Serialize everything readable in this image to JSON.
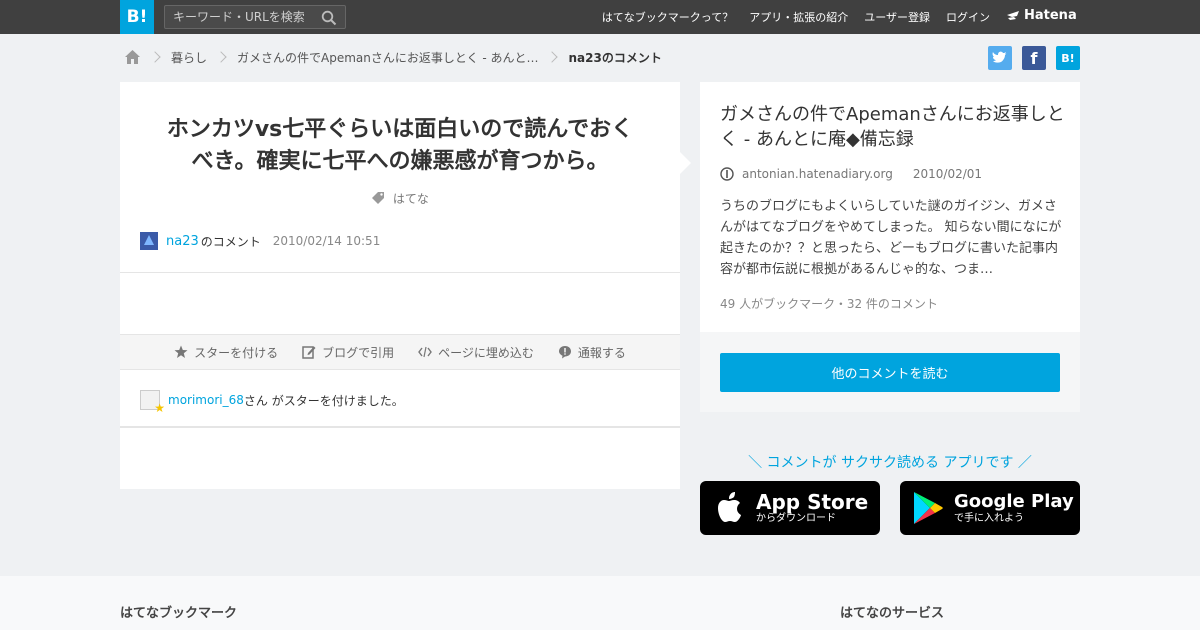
{
  "header": {
    "logo_text": "B!",
    "search_placeholder": "キーワード・URLを検索",
    "nav": [
      "はてなブックマークって？",
      "アプリ・拡張の紹介",
      "ユーザー登録",
      "ログイン"
    ],
    "brand": "Hatena"
  },
  "breadcrumb": {
    "items": [
      "暮らし",
      "ガメさんの件でApemanさんにお返事しとく - あんと…"
    ],
    "current": "na23のコメント"
  },
  "social": {
    "twitter": "t",
    "facebook": "f",
    "hatena": "B!"
  },
  "comment": {
    "text": "ホンカツvs七平ぐらいは面白いので読んでおくべき。確実に七平への嫌悪感が育つから。",
    "tag": "はてな",
    "user": "na23",
    "suffix": "のコメント",
    "time": "2010/02/14 10:51"
  },
  "actions": [
    "スターを付ける",
    "ブログで引用",
    "ページに埋め込む",
    "通報する"
  ],
  "star": {
    "user": "morimori_68",
    "text": "さん がスターを付けました。"
  },
  "entry": {
    "title": "ガメさんの件でApemanさんにお返事しとく - あんとに庵◆備忘録",
    "domain": "antonian.hatenadiary.org",
    "date": "2010/02/01",
    "excerpt": "うちのブログにもよくいらしていた謎のガイジン、ガメさんがはてなブログをやめてしまった。 知らない間になにが起きたのか？？と思ったら、どーもブログに書いた記事内容が都市伝説に根拠があるんじゃ的な、つま…",
    "stats": "49 人がブックマーク・32 件のコメント",
    "more_button": "他のコメントを読む"
  },
  "promo": {
    "text": "＼ コメントが サクサク読める アプリです ／",
    "appstore_big": "App Store",
    "appstore_small": "からダウンロード",
    "googleplay_big": "Google Play",
    "googleplay_small": "で手に入れよう"
  },
  "footer": {
    "left_heading": "はてなブックマーク",
    "right_heading": "はてなのサービス"
  },
  "colors": {
    "accent": "#00a4de",
    "topbar": "#404040",
    "twitter": "#55acee",
    "facebook": "#3b5998"
  }
}
